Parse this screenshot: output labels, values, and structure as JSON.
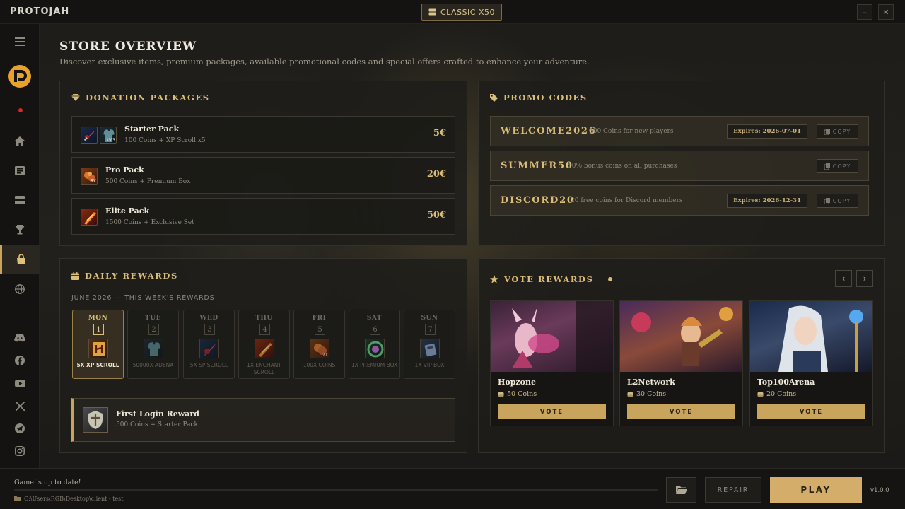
{
  "app": {
    "brand": "PROTOJAH",
    "server": "CLASSIC X50",
    "minimize": "–",
    "close": "✕"
  },
  "page": {
    "title": "STORE OVERVIEW",
    "subtitle": "Discover exclusive items, premium packages, available promotional codes and special offers crafted to enhance your adventure."
  },
  "donations": {
    "title": "DONATION PACKAGES",
    "packages": [
      {
        "name": "Starter Pack",
        "desc": "100 Coins + XP Scroll x5",
        "price": "5€"
      },
      {
        "name": "Pro Pack",
        "desc": "500 Coins + Premium Box",
        "price": "20€"
      },
      {
        "name": "Elite Pack",
        "desc": "1500 Coins + Exclusive Set",
        "price": "50€"
      }
    ],
    "item_badges": {
      "lv3": "LV.3",
      "x5": "5X",
      "x2": "2X"
    }
  },
  "promo": {
    "title": "PROMO CODES",
    "codes": [
      {
        "code": "WELCOME2026",
        "desc": "500 Coins for new players",
        "expires": "Expires: 2026-07-01",
        "copy": "COPY"
      },
      {
        "code": "SUMMER50",
        "desc": "50% bonus coins on all purchases",
        "expires": "",
        "copy": "COPY"
      },
      {
        "code": "DISCORD20",
        "desc": "20 free coins for Discord members",
        "expires": "Expires: 2026-12-31",
        "copy": "COPY"
      }
    ]
  },
  "daily": {
    "title": "DAILY REWARDS",
    "week_label": "JUNE 2026 — THIS WEEK'S REWARDS",
    "days": [
      {
        "name": "MON",
        "num": "1",
        "reward": "5X XP SCROLL"
      },
      {
        "name": "TUE",
        "num": "2",
        "reward": "50000X ADENA"
      },
      {
        "name": "WED",
        "num": "3",
        "reward": "5X SP SCROLL"
      },
      {
        "name": "THU",
        "num": "4",
        "reward": "1X ENCHANT SCROLL"
      },
      {
        "name": "FRI",
        "num": "5",
        "reward": "100X COINS"
      },
      {
        "name": "SAT",
        "num": "6",
        "reward": "1X PREMIUM BOX"
      },
      {
        "name": "SUN",
        "num": "7",
        "reward": "1X VIP BOX"
      }
    ],
    "first_login": {
      "title": "First Login Reward",
      "desc": "500 Coins + Starter Pack"
    }
  },
  "vote": {
    "title": "VOTE REWARDS",
    "prev": "‹",
    "next": "›",
    "sites": [
      {
        "name": "Hopzone",
        "coins": "50 Coins",
        "button": "VOTE"
      },
      {
        "name": "L2Network",
        "coins": "30 Coins",
        "button": "VOTE"
      },
      {
        "name": "Top100Arena",
        "coins": "20 Coins",
        "button": "VOTE"
      }
    ]
  },
  "footer": {
    "status": "Game is up to date!",
    "path": "C:\\Users\\RGB\\Desktop\\client - test",
    "repair": "REPAIR",
    "play": "PLAY",
    "version": "v1.0.0"
  },
  "colors": {
    "accent": "#c9a45c",
    "status_dot": "#d12c2c",
    "play_button": "#d3ad69"
  },
  "icons": {
    "sidebar": [
      "menu-icon",
      "logo-icon",
      "home-icon",
      "news-icon",
      "servers-icon",
      "trophy-icon",
      "store-icon",
      "globe-icon",
      "discord-icon",
      "facebook-icon",
      "youtube-icon",
      "x-icon",
      "telegram-icon",
      "instagram-icon"
    ]
  }
}
